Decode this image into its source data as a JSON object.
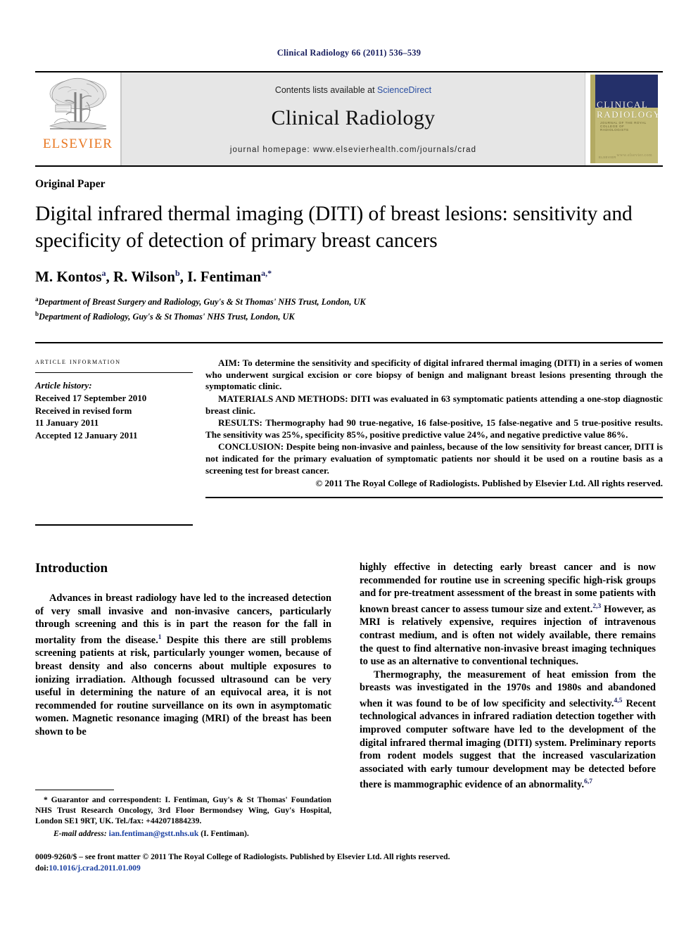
{
  "running_head": "Clinical Radiology 66 (2011) 536–539",
  "masthead": {
    "publisher_logo_text": "ELSEVIER",
    "contents_prefix": "Contents lists available at ",
    "contents_link": "ScienceDirect",
    "journal_name": "Clinical Radiology",
    "homepage": "journal homepage: www.elsevierhealth.com/journals/crad",
    "cover": {
      "line1": "CLINICAL",
      "line2": "RADIOLOGY",
      "subtitle": "JOURNAL OF THE ROYAL COLLEGE OF RADIOLOGISTS",
      "footer_left": "ELSEVIER",
      "footer_right": "www.elsevier.com"
    }
  },
  "article": {
    "type": "Original Paper",
    "title": "Digital infrared thermal imaging (DITI) of breast lesions: sensitivity and specificity of detection of primary breast cancers",
    "authors_html": "M. Kontos<sup>a</sup>, R. Wilson<sup>b</sup>, I. Fentiman<sup>a,*</sup>",
    "affiliations": [
      "Department of Breast Surgery and Radiology, Guy's & St Thomas' NHS Trust, London, UK",
      "Department of Radiology, Guy's & St Thomas' NHS Trust, London, UK"
    ],
    "affiliation_marks": [
      "a",
      "b"
    ]
  },
  "article_info": {
    "heading": "Article information",
    "history_label": "Article history:",
    "history": [
      "Received 17 September 2010",
      "Received in revised form",
      "11 January 2011",
      "Accepted 12 January 2011"
    ]
  },
  "abstract": {
    "aim": "AIM: To determine the sensitivity and specificity of digital infrared thermal imaging (DITI) in a series of women who underwent surgical excision or core biopsy of benign and malignant breast lesions presenting through the symptomatic clinic.",
    "materials": "MATERIALS AND METHODS: DITI was evaluated in 63 symptomatic patients attending a one-stop diagnostic breast clinic.",
    "results": "RESULTS: Thermography had 90 true-negative, 16 false-positive, 15 false-negative and 5 true-positive results. The sensitivity was 25%, specificity 85%, positive predictive value 24%, and negative predictive value 86%.",
    "conclusion": "CONCLUSION: Despite being non-invasive and painless, because of the low sensitivity for breast cancer, DITI is not indicated for the primary evaluation of symptomatic patients nor should it be used on a routine basis as a screening test for breast cancer.",
    "copyright": "© 2011 The Royal College of Radiologists. Published by Elsevier Ltd. All rights reserved."
  },
  "introduction": {
    "heading": "Introduction",
    "left_paragraph_html": "Advances in breast radiology have led to the increased detection of very small invasive and non-invasive cancers, particularly through screening and this is in part the reason for the fall in mortality from the disease.<sup>1</sup> Despite this there are still problems screening patients at risk, particularly younger women, because of breast density and also concerns about multiple exposures to ionizing irradiation. Although focussed ultrasound can be very useful in determining the nature of an equivocal area, it is not recommended for routine surveillance on its own in asymptomatic women. Magnetic resonance imaging (MRI) of the breast has been shown to be",
    "right_paragraph_1_html": "highly effective in detecting early breast cancer and is now recommended for routine use in screening specific high-risk groups and for pre-treatment assessment of the breast in some patients with known breast cancer to assess tumour size and extent.<sup>2,3</sup> However, as MRI is relatively expensive, requires injection of intravenous contrast medium, and is often not widely available, there remains the quest to find alternative non-invasive breast imaging techniques to use as an alternative to conventional techniques.",
    "right_paragraph_2_html": "Thermography, the measurement of heat emission from the breasts was investigated in the 1970s and 1980s and abandoned when it was found to be of low specificity and selectivity.<sup>4,5</sup> Recent technological advances in infrared radiation detection together with improved computer software have led to the development of the digital infrared thermal imaging (DITI) system. Preliminary reports from rodent models suggest that the increased vascularization associated with early tumour development may be detected before there is mammographic evidence of an abnormality.<sup>6,7</sup>"
  },
  "footnote": {
    "correspondence": "* Guarantor and correspondent: I. Fentiman, Guy's & St Thomas' Foundation NHS Trust Research Oncology, 3rd Floor Bermondsey Wing, Guy's Hospital, London SE1 9RT, UK. Tel./fax: +442071884239.",
    "email_label": "E-mail address:",
    "email": "ian.fentiman@gstt.nhs.uk",
    "email_suffix": "(I. Fentiman)."
  },
  "imprint": {
    "line1": "0009-9260/$ – see front matter © 2011 The Royal College of Radiologists. Published by Elsevier Ltd. All rights reserved.",
    "doi_prefix": "doi:",
    "doi": "10.1016/j.crad.2011.01.009"
  },
  "colors": {
    "running_head": "#1a2060",
    "link": "#1a3fa0",
    "elsevier_orange": "#E87722",
    "cover_navy": "#24306a",
    "cover_khaki": "#c3bb77",
    "banner_grey": "#e6e6e6"
  }
}
